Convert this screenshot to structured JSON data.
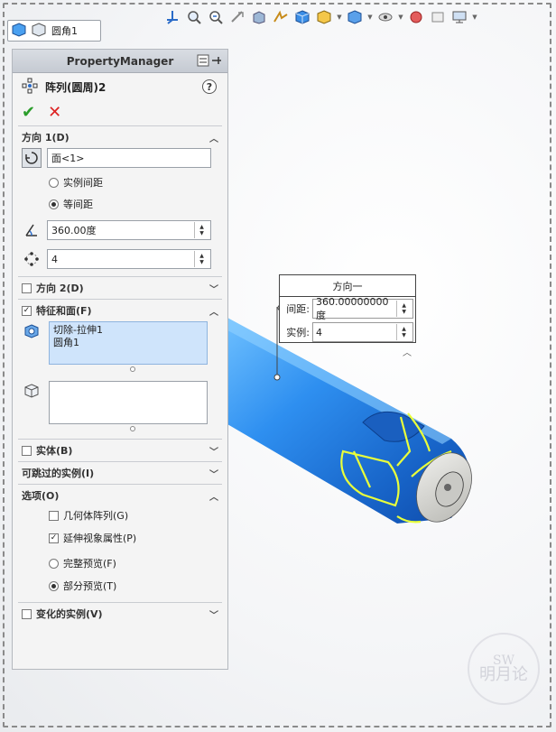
{
  "tree_tab": {
    "label": "圆角1"
  },
  "property_manager": {
    "header": "PropertyManager",
    "title": "阵列(圆周)2",
    "help": "?",
    "direction1": {
      "label": "方向 1(D)",
      "face_field": "面<1>",
      "option_instance_spacing": "实例间距",
      "option_equal_spacing": "等间距",
      "angle_value": "360.00度",
      "count_value": "4"
    },
    "direction2": {
      "label": "方向 2(D)"
    },
    "features_faces": {
      "label": "特征和面(F)",
      "items": [
        "切除-拉伸1",
        "圆角1"
      ]
    },
    "bodies": {
      "label": "实体(B)"
    },
    "skip_instances": {
      "label": "可跳过的实例(I)"
    },
    "options": {
      "label": "选项(O)",
      "geometry_pattern": "几何体阵列(G)",
      "propagate_visual": "延伸视象属性(P)",
      "full_preview": "完整预览(F)",
      "partial_preview": "部分预览(T)"
    },
    "varying_instances": {
      "label": "变化的实例(V)"
    }
  },
  "callout": {
    "title": "方向一",
    "spacing_label": "间距:",
    "spacing_value": "360.00000000度",
    "instances_label": "实例:",
    "instances_value": "4"
  },
  "watermark": {
    "line1": "SW",
    "line2": "明月论"
  },
  "colors": {
    "part_blue": "#2e8ff0",
    "edge_yellow": "#e9ff3b",
    "end_gray": "#d7d7d4"
  }
}
